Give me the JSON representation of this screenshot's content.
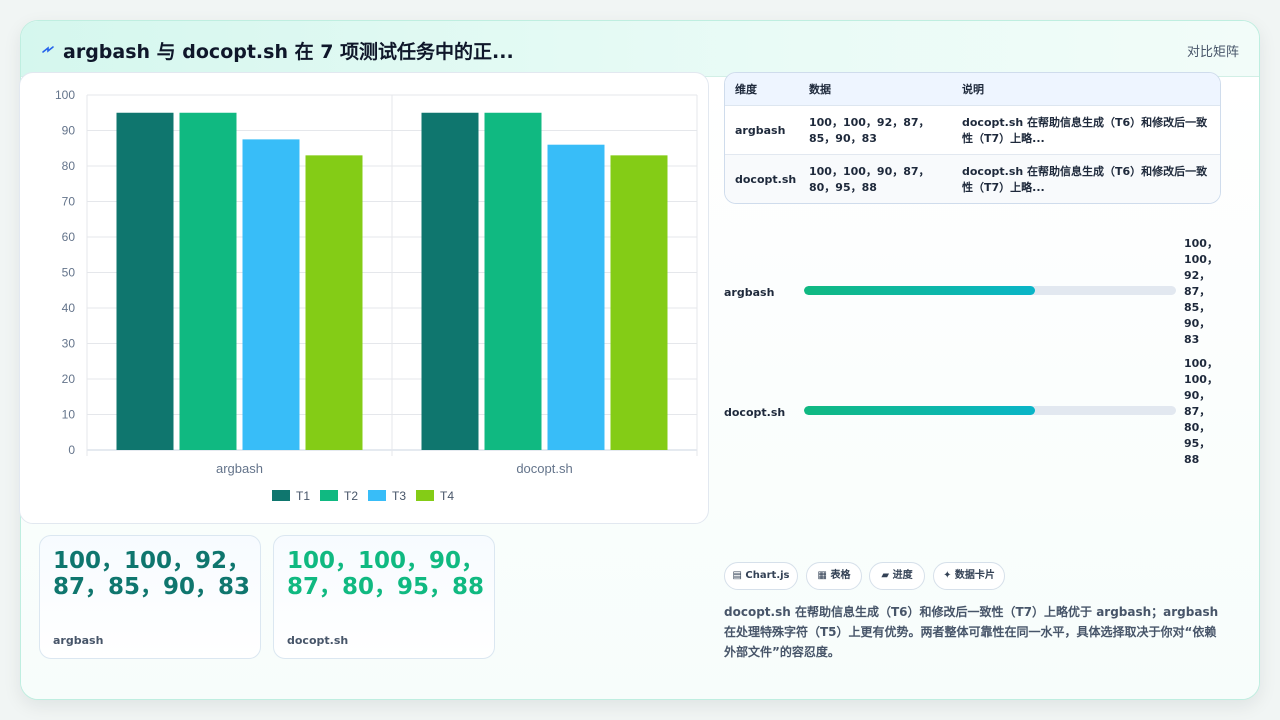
{
  "header": {
    "title": "argbash 与 docopt.sh 在 7 项测试任务中的正...",
    "view_label": "对比矩阵"
  },
  "colors": {
    "T1": "#0f766e",
    "T2": "#10b981",
    "T3": "#38bdf8",
    "T4": "#84cc16",
    "progress_start": "#10b981",
    "progress_end": "#0ab5c8"
  },
  "chart_data": {
    "type": "bar",
    "categories": [
      "argbash",
      "docopt.sh"
    ],
    "series": [
      {
        "name": "T1",
        "values": [
          95,
          95
        ]
      },
      {
        "name": "T2",
        "values": [
          95,
          95
        ]
      },
      {
        "name": "T3",
        "values": [
          87.5,
          86
        ]
      },
      {
        "name": "T4",
        "values": [
          83,
          83
        ]
      }
    ],
    "ylim": [
      0,
      100
    ],
    "yticks": [
      0,
      10,
      20,
      30,
      40,
      50,
      60,
      70,
      80,
      90,
      100
    ],
    "grid": true,
    "legend": "bottom"
  },
  "stat_cards": [
    {
      "value": "100，100，92，87，85，90，83",
      "label": "argbash"
    },
    {
      "value": "100，100，90，87，80，95，88",
      "label": "docopt.sh"
    }
  ],
  "table": {
    "headers": [
      "维度",
      "数据",
      "说明"
    ],
    "rows": [
      {
        "dim": "argbash",
        "data": "100，100，92，87，85，90，83",
        "desc": "docopt.sh 在帮助信息生成（T6）和修改后一致性（T7）上略..."
      },
      {
        "dim": "docopt.sh",
        "data": "100，100，90，87，80，95，88",
        "desc": "docopt.sh 在帮助信息生成（T6）和修改后一致性（T7）上略..."
      }
    ]
  },
  "progress": [
    {
      "label": "argbash",
      "value": "100，100，92，87，85，90，83",
      "fraction": 0.62
    },
    {
      "label": "docopt.sh",
      "value": "100，100，90，87，80，95，88",
      "fraction": 0.62
    }
  ],
  "chips": [
    {
      "icon": "chart-icon",
      "label": "▤ Chart.js"
    },
    {
      "icon": "table-icon",
      "label": "▦ 表格"
    },
    {
      "icon": "progress-icon",
      "label": "▰ 进度"
    },
    {
      "icon": "sparkle-icon",
      "label": "✦ 数据卡片"
    }
  ],
  "summary": "docopt.sh 在帮助信息生成（T6）和修改后一致性（T7）上略优于 argbash；argbash 在处理特殊字符（T5）上更有优势。两者整体可靠性在同一水平，具体选择取决于你对“依赖外部文件”的容忍度。"
}
